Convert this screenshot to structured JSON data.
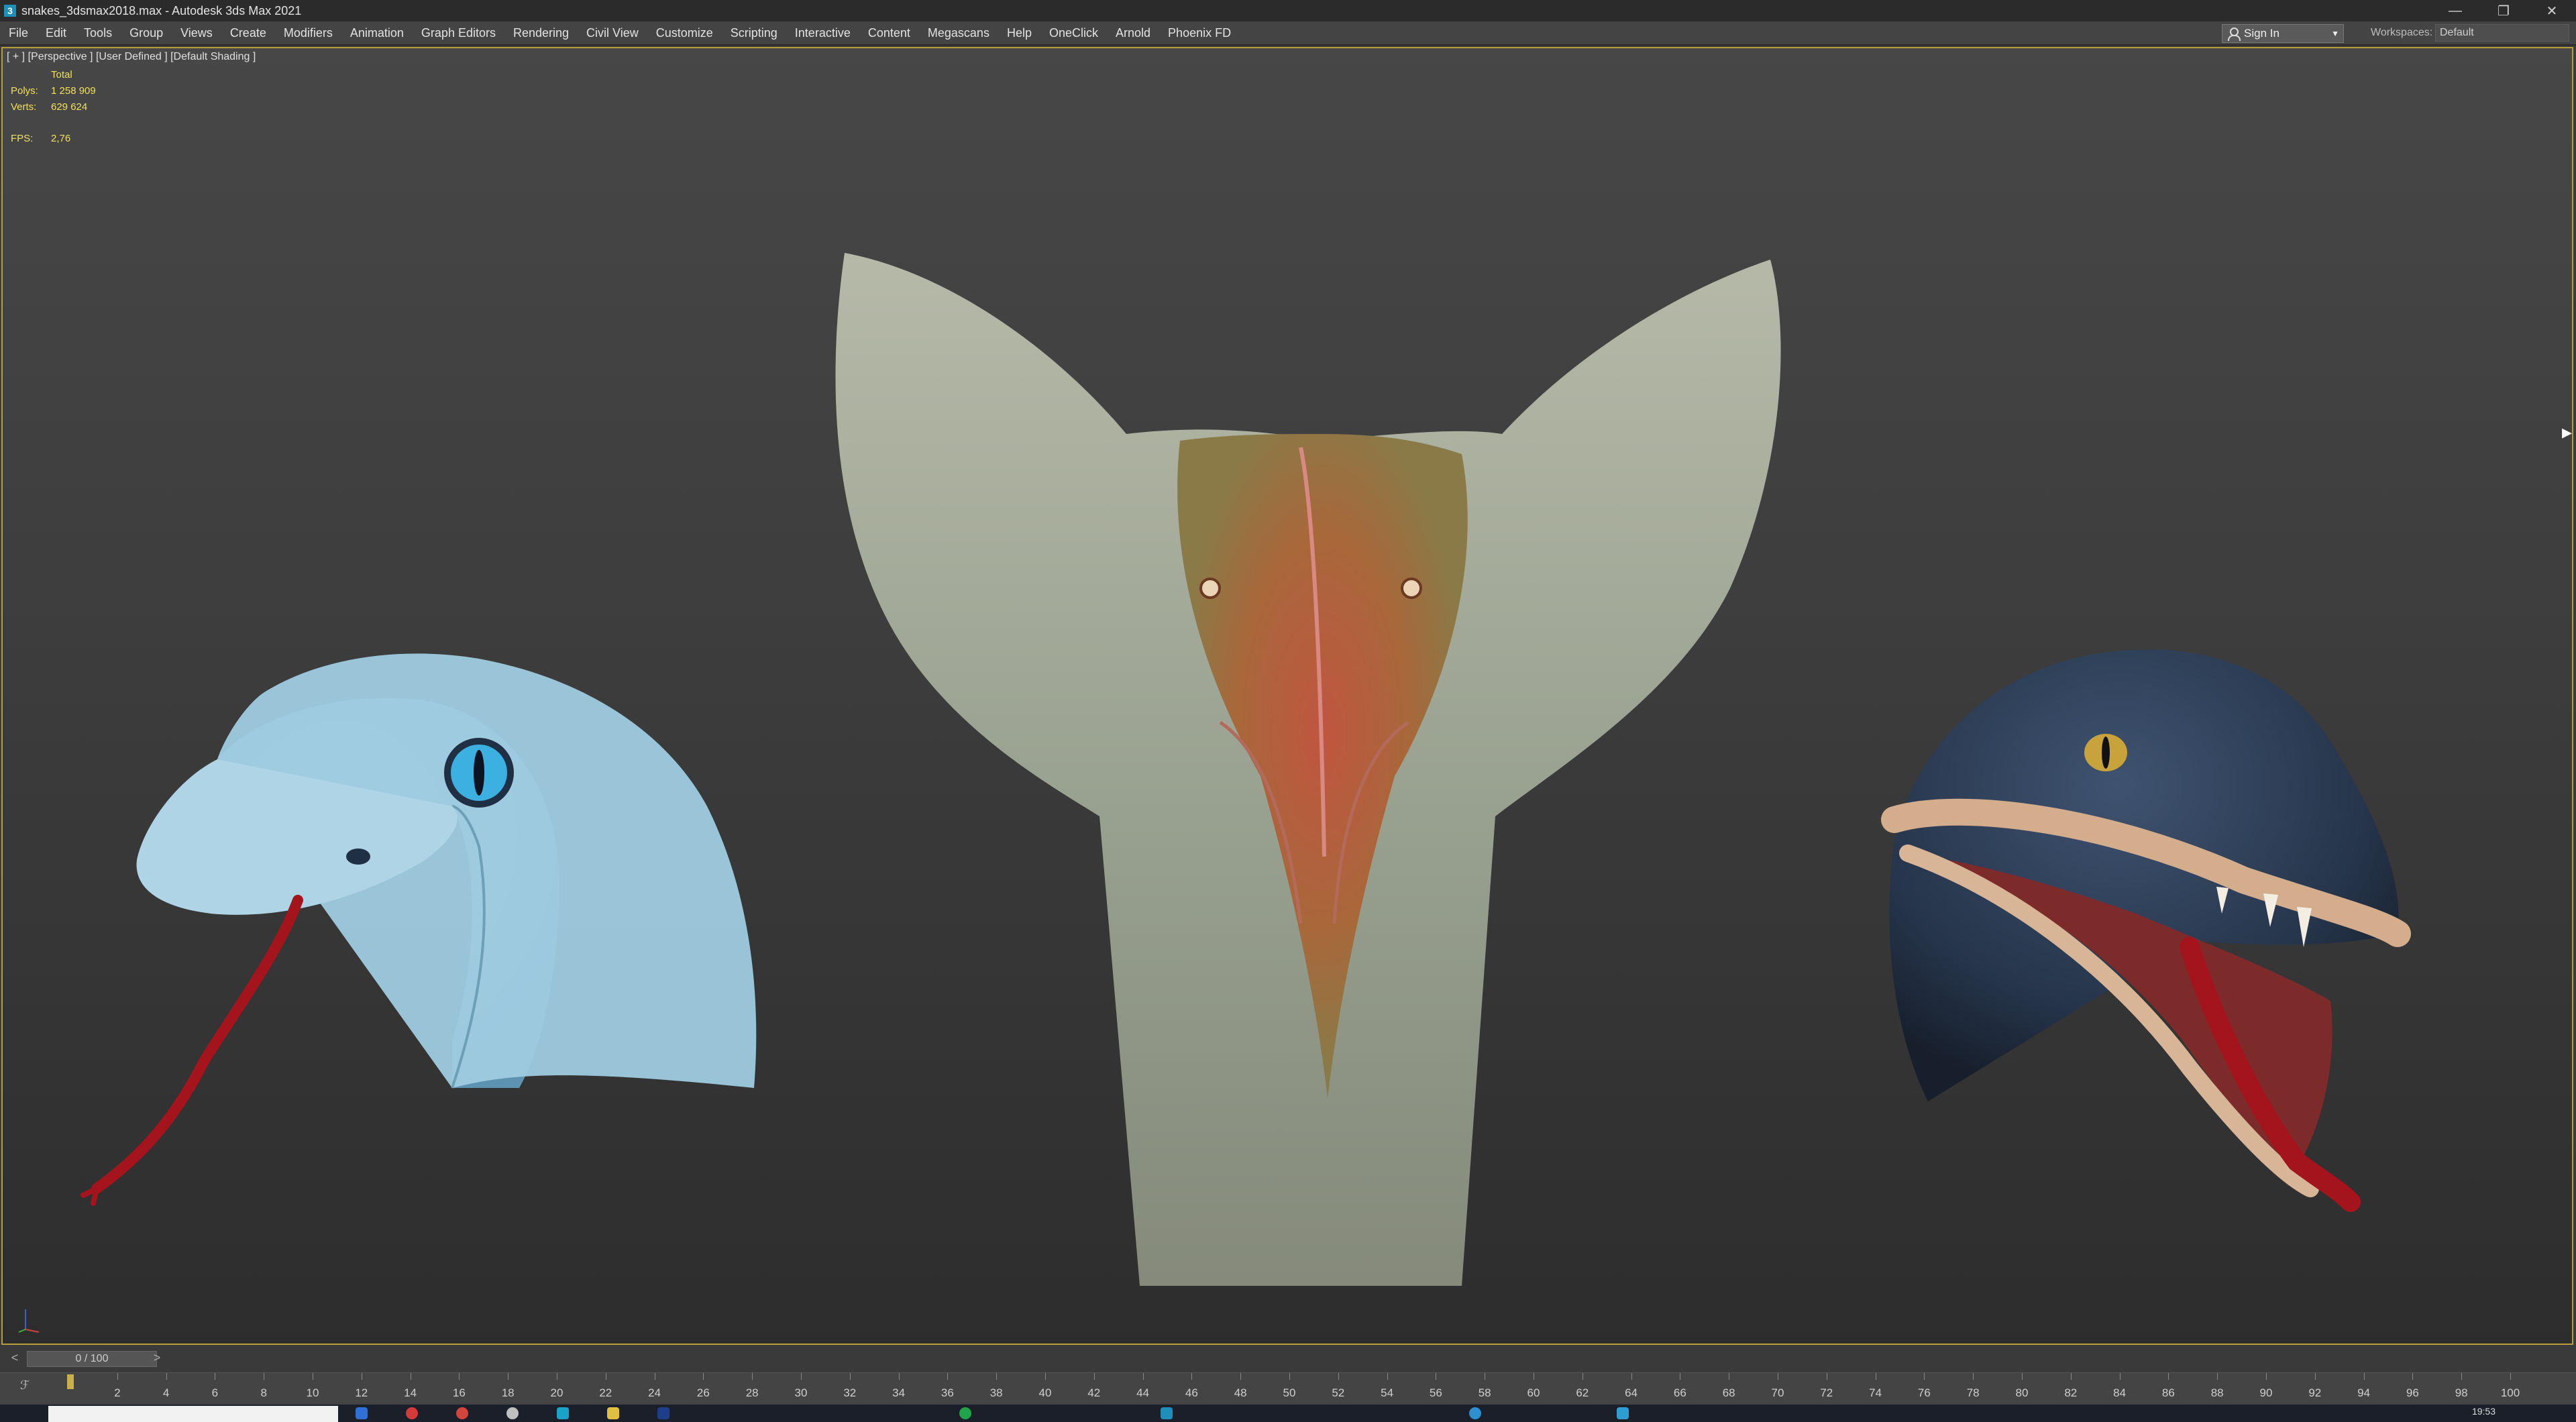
{
  "window": {
    "title": "snakes_3dsmax2018.max - Autodesk 3ds Max 2021",
    "app_icon_letter": "3",
    "controls": [
      "minimize-icon",
      "restore-icon",
      "close-icon"
    ]
  },
  "menu": {
    "items": [
      "File",
      "Edit",
      "Tools",
      "Group",
      "Views",
      "Create",
      "Modifiers",
      "Animation",
      "Graph Editors",
      "Rendering",
      "Civil View",
      "Customize",
      "Scripting",
      "Interactive",
      "Content",
      "Megascans",
      "Help",
      "OneClick",
      "Arnold",
      "Phoenix FD"
    ],
    "sign_in": "Sign In",
    "workspaces_label": "Workspaces:",
    "workspaces_value": "Default"
  },
  "viewport": {
    "label": "[ + ] [Perspective ] [User Defined ] [Default Shading ]",
    "stats": {
      "header": "Total",
      "polys_label": "Polys:",
      "polys_value": "1 258 909",
      "verts_label": "Verts:",
      "verts_value": "629 624"
    },
    "fps_label": "FPS:",
    "fps_value": "2,76",
    "models": [
      "blue-snake-head",
      "cobra-hood",
      "dark-viper-head"
    ]
  },
  "timeline": {
    "frame_display": "0 / 100",
    "prev": "<",
    "next": ">",
    "ticks": [
      "2",
      "4",
      "6",
      "8",
      "10",
      "12",
      "14",
      "16",
      "18",
      "20",
      "22",
      "24",
      "26",
      "28",
      "30",
      "32",
      "34",
      "36",
      "38",
      "40",
      "42",
      "44",
      "46",
      "48",
      "50",
      "52",
      "54",
      "56",
      "58",
      "60",
      "62",
      "64",
      "66",
      "68",
      "70",
      "72",
      "74",
      "76",
      "78",
      "80",
      "82",
      "84",
      "86",
      "88",
      "90",
      "92",
      "94",
      "96",
      "98",
      "100"
    ]
  },
  "taskbar": {
    "clock": "19:53"
  },
  "colors": {
    "viewport_border": "#b79d3c",
    "stats_text": "#f0e05c",
    "blue_snake": "#8fc1d9",
    "cobra": "#9aa396",
    "viper": "#2a3a52",
    "tongue": "#a3141c"
  }
}
